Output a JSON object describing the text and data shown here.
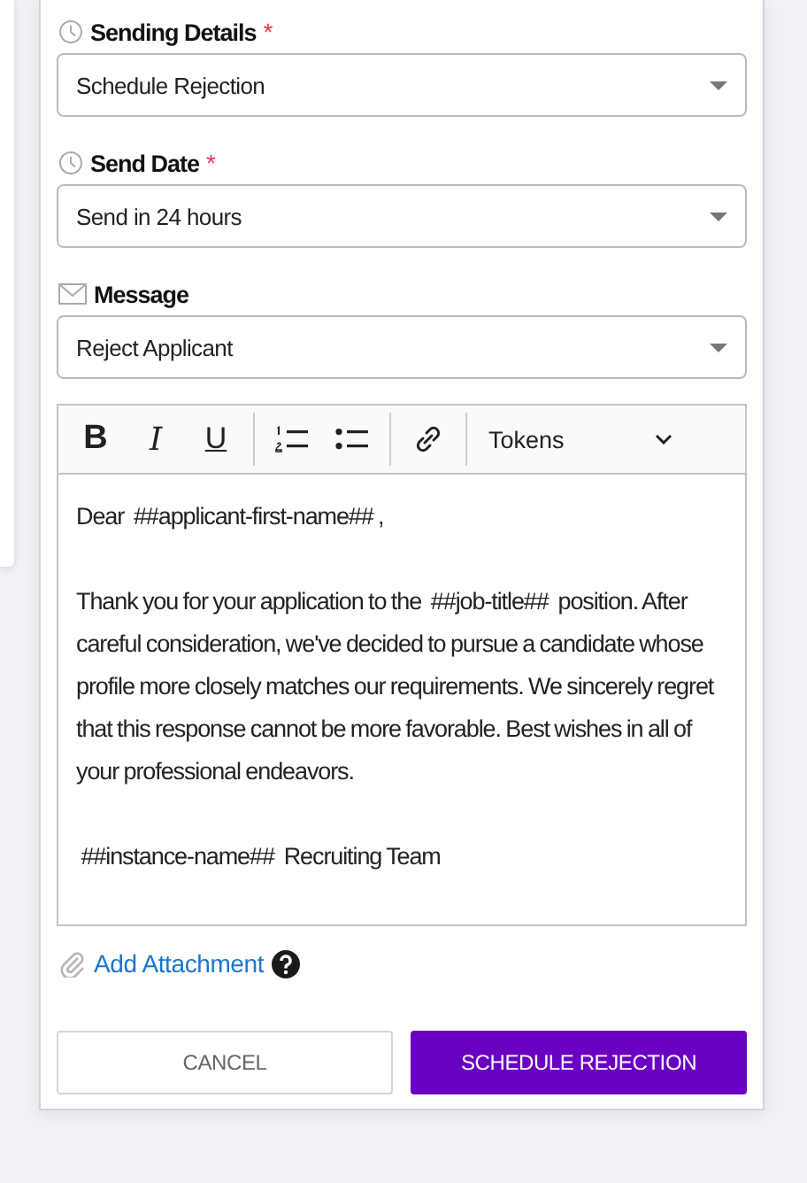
{
  "fields": [
    {
      "kind": "clock",
      "label": "Sending Details",
      "required_mark": "*",
      "value": "Schedule Rejection"
    },
    {
      "kind": "clock",
      "label": "Send Date",
      "required_mark": "*",
      "value": "Send in 24 hours"
    },
    {
      "kind": "envelope",
      "label": "Message",
      "value": "Reject Applicant"
    }
  ],
  "editor": {
    "toolbar": [
      {
        "kind": "bold",
        "label": "B"
      },
      {
        "kind": "italic",
        "label": "I"
      },
      {
        "kind": "underline",
        "label": "U"
      },
      {
        "kind": "divider"
      },
      {
        "kind": "ordered-list"
      },
      {
        "kind": "bullet-list"
      },
      {
        "kind": "divider"
      },
      {
        "kind": "link"
      },
      {
        "kind": "divider"
      },
      {
        "kind": "dropdown",
        "label": "Tokens"
      }
    ],
    "paragraphs": [
      "Dear  ##applicant-first-name## ,",
      "Thank you for your application to the  ##job-title##  position. After careful consideration, we've decided to pursue a candidate whose profile more closely matches our requirements. We sincerely regret that this response cannot be more favorable. Best wishes in all of your professional endeavors.",
      " ##instance-name##  Recruiting Team"
    ]
  },
  "attachment": {
    "label": "Add Attachment"
  },
  "buttons": [
    {
      "kind": "secondary",
      "label": "CANCEL"
    },
    {
      "kind": "primary",
      "label": "SCHEDULE REJECTION"
    }
  ]
}
